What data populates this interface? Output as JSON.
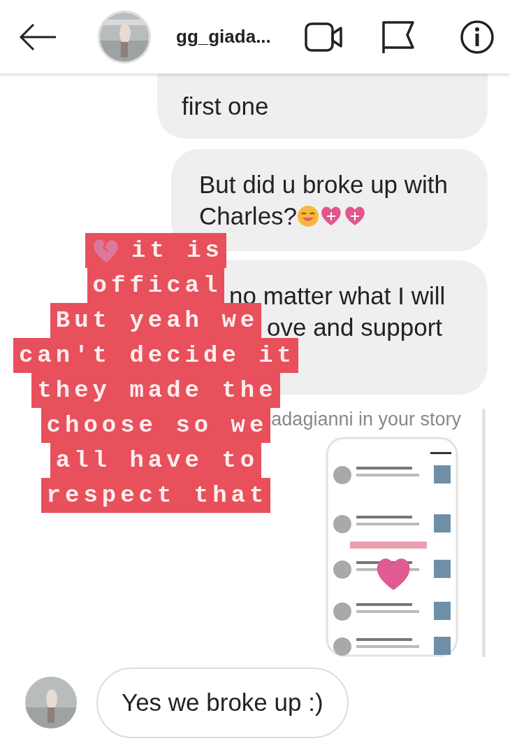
{
  "header": {
    "username": "gg_giada..."
  },
  "messages": [
    {
      "kind": "sent",
      "lines": [
        "first one"
      ]
    },
    {
      "kind": "sent_emoji",
      "lines": [
        "But did u broke up with",
        "Charles?"
      ]
    },
    {
      "kind": "sent",
      "lines": [
        "no matter what I will",
        "ove and support"
      ]
    },
    {
      "kind": "story_reply",
      "label": "adagianni in your story"
    },
    {
      "kind": "received",
      "lines": [
        "Yes we broke up :)"
      ]
    }
  ],
  "sticker": {
    "lines": [
      "it is",
      "offical",
      "But yeah we",
      "can't decide it",
      "they made the",
      "choose so we",
      "all have to",
      "respect that"
    ]
  }
}
